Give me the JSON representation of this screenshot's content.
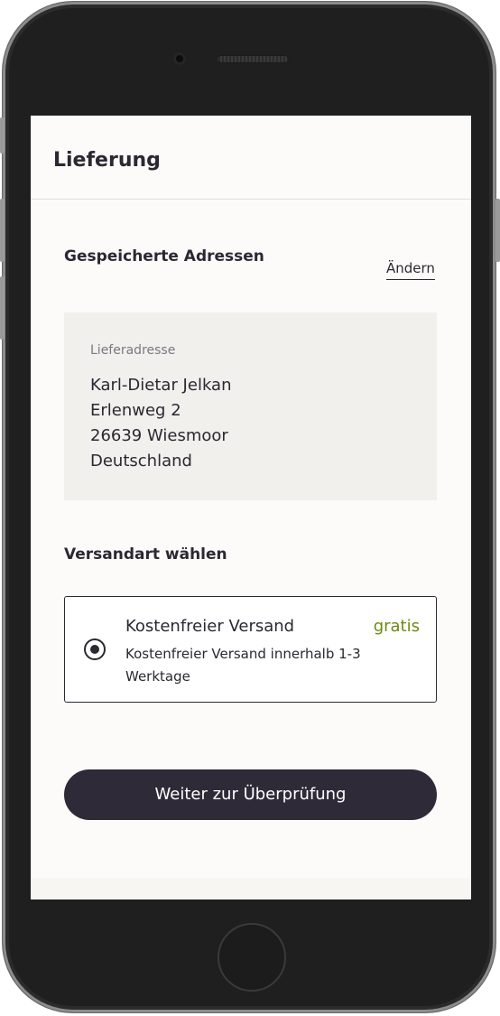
{
  "header": {
    "title": "Lieferung"
  },
  "saved_addresses": {
    "title": "Gespeicherte Adressen",
    "change_link": "Ändern",
    "address": {
      "label": "Lieferadresse",
      "name": "Karl-Dietar Jelkan",
      "street": "Erlenweg 2",
      "city": "26639 Wiesmoor",
      "country": "Deutschland"
    }
  },
  "shipping": {
    "title": "Versandart wählen",
    "option": {
      "title": "Kostenfreier Versand",
      "description": "Kostenfreier Versand innerhalb 1-3 Werktage",
      "price": "gratis",
      "selected": true
    }
  },
  "actions": {
    "continue_label": "Weiter zur Überprüfung"
  },
  "colors": {
    "primary": "#2f2a38",
    "accent_price": "#6b8a12",
    "address_background": "#f1f0ec",
    "screen_background": "#fcfbf9"
  }
}
